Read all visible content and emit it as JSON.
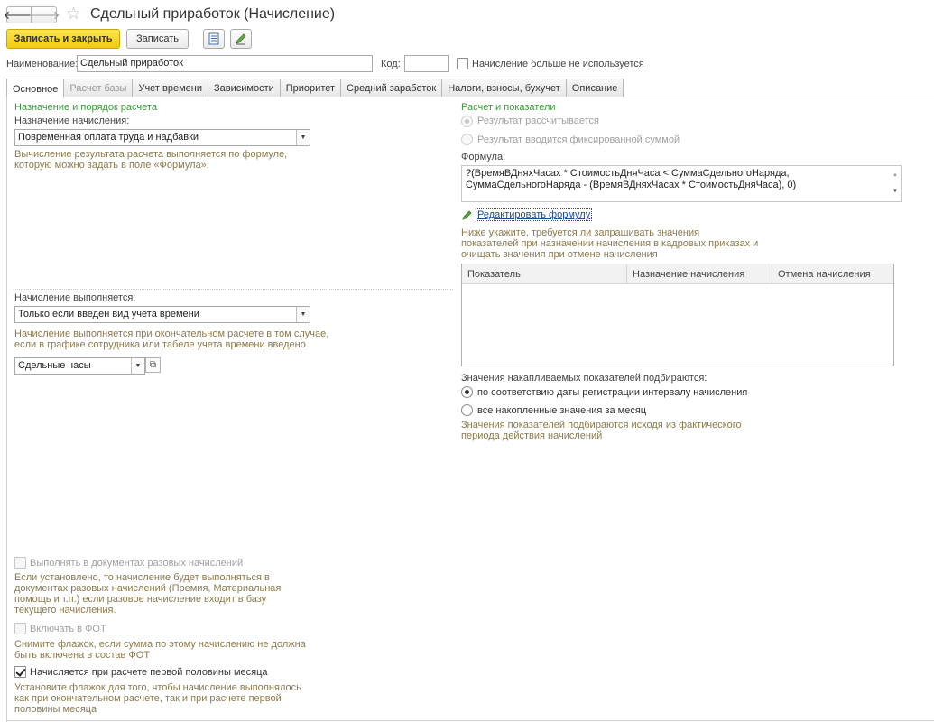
{
  "window": {
    "title": "Сдельный приработок (Начисление)"
  },
  "toolbar": {
    "save_close_label": "Записать и закрыть",
    "save_label": "Записать"
  },
  "header": {
    "name_label": "Наименование:",
    "name_value": "Сдельный приработок",
    "code_label": "Код:",
    "code_value": "",
    "not_used_label": "Начисление больше не используется",
    "not_used_checked": false
  },
  "tabs": [
    {
      "label": "Основное",
      "active": true
    },
    {
      "label": "Расчет базы",
      "disabled": true
    },
    {
      "label": "Учет времени"
    },
    {
      "label": "Зависимости"
    },
    {
      "label": "Приоритет"
    },
    {
      "label": "Средний заработок"
    },
    {
      "label": "Налоги, взносы, бухучет"
    },
    {
      "label": "Описание"
    }
  ],
  "left": {
    "section_title": "Назначение и порядок расчета",
    "purpose_label": "Назначение начисления:",
    "purpose_value": "Повременная оплата труда и надбавки",
    "purpose_hint_1": "Вычисление результата расчета выполняется по формуле,",
    "purpose_hint_2": "которую можно задать в поле «Формула».",
    "performed_label": "Начисление выполняется:",
    "performed_value": "Только если введен вид учета времени",
    "performed_hint_1": "Начисление выполняется при окончательном расчете в том случае,",
    "performed_hint_2": "если в графике сотрудника или табеле учета времени введено",
    "time_type_value": "Сдельные часы",
    "one_time_label": "Выполнять в документах разовых начислений",
    "one_time_hint_1": "Если установлено, то начисление будет выполняться в",
    "one_time_hint_2": "документах разовых начислений (Премия, Материальная",
    "one_time_hint_3": "помощь и т.п.) если разовое начисление входит в базу",
    "one_time_hint_4": "текущего начисления.",
    "fot_label": "Включать в ФОТ",
    "fot_hint_1": "Снимите флажок, если сумма по этому начислению не должна",
    "fot_hint_2": "быть включена в состав ФОТ",
    "first_half_label": "Начисляется при расчете первой половины месяца",
    "first_half_checked": true,
    "first_half_hint_1": "Установите флажок для того, чтобы начисление выполнялось",
    "first_half_hint_2": "как при окончательном расчете, так и при расчете первой",
    "first_half_hint_3": "половины месяца"
  },
  "right": {
    "section_title": "Расчет и показатели",
    "radio_calc_label": "Результат рассчитывается",
    "radio_fixed_label": "Результат вводится фиксированной суммой",
    "formula_label": "Формула:",
    "formula_line_1": "?(ВремяВДняхЧасах * СтоимостьДняЧаса < СуммаСдельногоНаряда,",
    "formula_line_2": "СуммаСдельногоНаряда - (ВремяВДняхЧасах * СтоимостьДняЧаса), 0)",
    "edit_formula_link": "Редактировать формулу",
    "indicators_hint_1": "Ниже укажите, требуется ли запрашивать значения",
    "indicators_hint_2": "показателей при назначении начисления в кадровых приказах и",
    "indicators_hint_3": "очищать значения при отмене начисления",
    "table_columns": [
      "Показатель",
      "Назначение начисления",
      "Отмена начисления"
    ],
    "accum_label": "Значения накапливаемых показателей подбираются:",
    "accum_option_1": "по соответствию даты регистрации интервалу начисления",
    "accum_option_2": "все накопленные значения за месяц",
    "accum_hint_1": "Значения показателей подбираются исходя из фактического",
    "accum_hint_2": "периода действия начислений"
  }
}
